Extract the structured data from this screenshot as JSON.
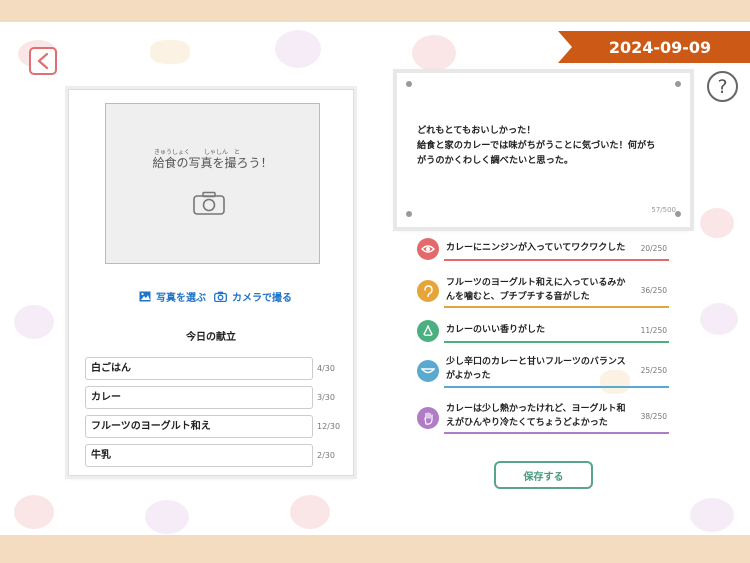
{
  "header": {
    "date": "2024-09-09",
    "back_icon": "chevron-left-icon",
    "help_label": "?"
  },
  "photo": {
    "ruby_kyushoku": "きゅうしょく",
    "ruby_shashin": "しゃしん",
    "ruby_to": "と",
    "prompt": "給食の写真を撮ろう！",
    "select_label": "写真を選ぶ",
    "camera_label": "カメラで撮る"
  },
  "menu": {
    "title": "今日の献立",
    "items": [
      {
        "name": "白ごはん",
        "count": "4/30"
      },
      {
        "name": "カレー",
        "count": "3/30"
      },
      {
        "name": "フルーツのヨーグルト和え",
        "count": "12/30"
      },
      {
        "name": "牛乳",
        "count": "2/30"
      }
    ]
  },
  "note": {
    "line1": "どれもとてもおいしかった！",
    "line2": "給食と家のカレーでは味がちがうことに気づいた！何がち",
    "line3": "がうのかくわしく調べたいと思った。",
    "count": "57/500"
  },
  "senses": [
    {
      "icon": "eye-icon",
      "color": "#e26a6a",
      "line1": "カレーにニンジンが入っていてワクワクした",
      "line2": "",
      "count": "20/250"
    },
    {
      "icon": "ear-icon",
      "color": "#e6a53a",
      "line1": "フルーツのヨーグルト和えに入っているみか",
      "line2": "んを噛むと、プチプチする音がした",
      "count": "36/250"
    },
    {
      "icon": "nose-icon",
      "color": "#4caf7f",
      "line1": "カレーのいい香りがした",
      "line2": "",
      "count": "11/250"
    },
    {
      "icon": "mouth-icon",
      "color": "#5aaad0",
      "line1": "少し辛口のカレーと甘いフルーツのバランス",
      "line2": "がよかった",
      "count": "25/250"
    },
    {
      "icon": "hand-icon",
      "color": "#b07cc6",
      "line1": "カレーは少し熱かったけれど、ヨーグルト和",
      "line2": "えがひんやり冷たくてちょうどよかった",
      "count": "38/250"
    }
  ],
  "actions": {
    "save_label": "保存する"
  },
  "colors": {
    "accent": "#cc5a16",
    "band": "#f3dcc0",
    "link": "#1f73c8",
    "save": "#5aa58a"
  }
}
